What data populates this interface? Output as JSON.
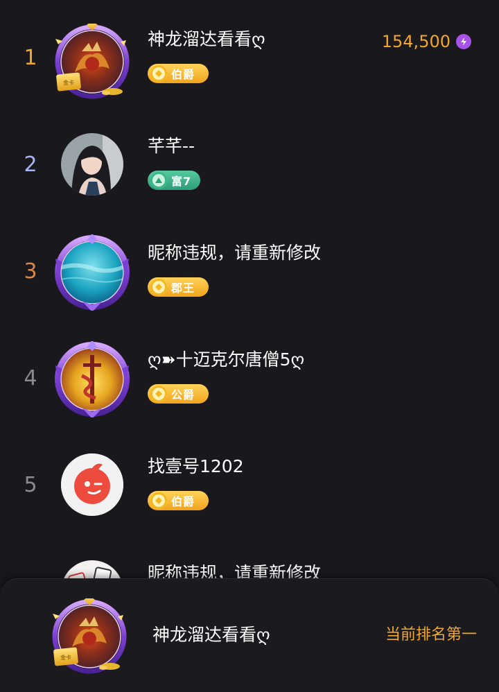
{
  "ranking": [
    {
      "rank": "1",
      "rank_color": "#f0a72a",
      "name": "神龙溜达看看ღ",
      "badge": "伯爵",
      "badge_style": "gold",
      "score": "154,500",
      "avatar": "dragon-avatar",
      "frame": "gold-card-purple-frame"
    },
    {
      "rank": "2",
      "rank_color": "#a9b3f5",
      "name": "芊芊--",
      "badge": "富7",
      "badge_style": "green",
      "avatar": "girl-photo-avatar",
      "frame": "none"
    },
    {
      "rank": "3",
      "rank_color": "#d98a49",
      "name": "昵称违规，请重新修改",
      "badge": "郡王",
      "badge_style": "gold",
      "avatar": "underwater-avatar",
      "frame": "purple-frame"
    },
    {
      "rank": "4",
      "rank_color": "#8a8a90",
      "name": "ღ➽十迈克尔唐僧5ღ",
      "badge": "公爵",
      "badge_style": "gold",
      "avatar": "sword-avatar",
      "frame": "purple-frame"
    },
    {
      "rank": "5",
      "rank_color": "#8a8a90",
      "name": "找壹号1202",
      "badge": "伯爵",
      "badge_style": "gold",
      "avatar": "wink-face-avatar",
      "frame": "none"
    },
    {
      "rank": "",
      "rank_color": "#8a8a90",
      "name": "昵称违规，请重新修改",
      "avatar": "card-pattern-avatar",
      "frame": "none"
    }
  ],
  "current_user": {
    "name": "神龙溜达看看ღ",
    "status": "当前排名第一",
    "avatar": "dragon-avatar",
    "frame": "gold-card-purple-frame"
  },
  "colors": {
    "background": "#19181d",
    "accent_orange": "#f0a72a",
    "badge_gold": "#f1a41d",
    "badge_green": "#2d9d78",
    "bolt_purple": "#a652e6"
  }
}
